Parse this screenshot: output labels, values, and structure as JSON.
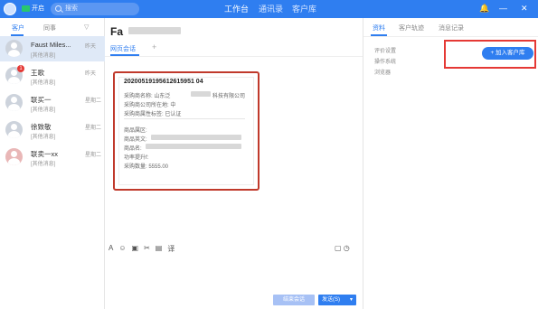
{
  "topbar": {
    "status": "开启",
    "search_placeholder": "搜索",
    "nav": [
      "工作台",
      "通讯录",
      "客户库"
    ]
  },
  "left": {
    "tabs": [
      "客户",
      "同事"
    ],
    "contacts": [
      {
        "name": "Faust Miles...",
        "sub": "[其他消息]",
        "day": "昨天",
        "selected": true
      },
      {
        "name": "王歌",
        "sub": "[其他消息]",
        "day": "昨天",
        "badge": "1"
      },
      {
        "name": "联买一",
        "sub": "[其他消息]",
        "day": "星期二"
      },
      {
        "name": "徐致敬",
        "sub": "[其他消息]",
        "day": "星期二"
      },
      {
        "name": "联卖一xx",
        "sub": "[其他消息]",
        "day": "星期二"
      }
    ]
  },
  "middle": {
    "title": "Fa",
    "sub_tab": "网页会话",
    "card": {
      "id": "20200519195612615951 04",
      "lines": [
        "采购商名称: 山东泛",
        "采购商公司所在地: 中",
        "采购商属性标签: 已认证",
        "商品属区:",
        "商品英文:",
        "商品名:",
        "功率提升f:",
        "采购数量: 5555.00"
      ],
      "company_suffix": "科技有限公司"
    },
    "buttons": {
      "end": "结束会话",
      "send": "发送(S)"
    }
  },
  "right": {
    "tabs": [
      "资料",
      "客户轨迹",
      "消息记录"
    ],
    "info": [
      "评价设置",
      "操作系统",
      "浏览器"
    ],
    "add_button": "+ 加入客户库"
  }
}
